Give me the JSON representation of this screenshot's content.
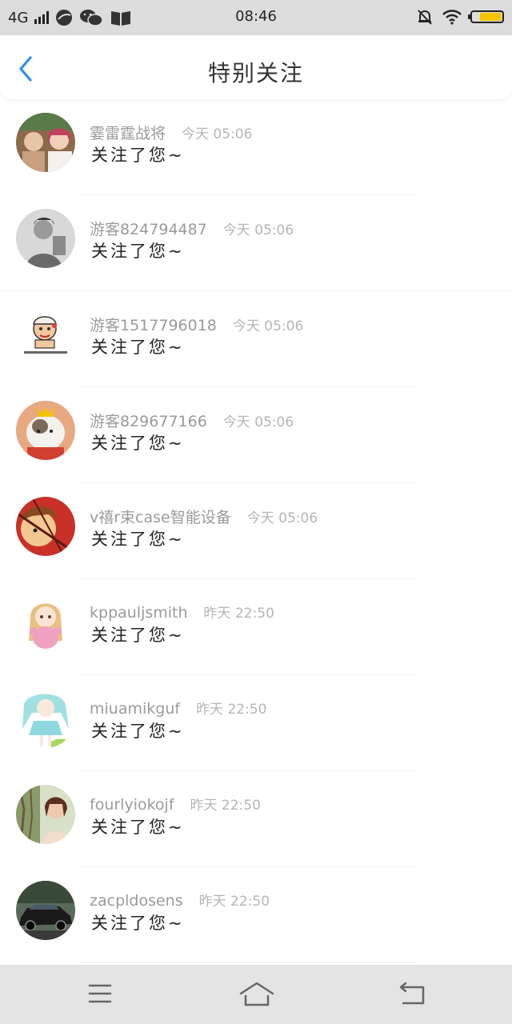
{
  "status_bar": {
    "network": "4G",
    "time": "08:46"
  },
  "header": {
    "title": "特别关注"
  },
  "items": [
    {
      "name": "霎雷霆战将",
      "time": "今天 05:06",
      "message": "关注了您~",
      "avatar_icon": "avatar-photo-two-women"
    },
    {
      "name": "游客824794487",
      "time": "今天 05:06",
      "message": "关注了您~",
      "avatar_icon": "avatar-photo-grayscale-man"
    },
    {
      "name": "游客1517796018",
      "time": "今天 05:06",
      "message": "关注了您~",
      "avatar_icon": "avatar-cartoon-meme"
    },
    {
      "name": "游客829677166",
      "time": "今天 05:06",
      "message": "关注了您~",
      "avatar_icon": "avatar-photo-hamster"
    },
    {
      "name": "v禧r束case智能设备",
      "time": "今天 05:06",
      "message": "关注了您~",
      "avatar_icon": "avatar-anime-red"
    },
    {
      "name": "kppauljsmith",
      "time": "昨天 22:50",
      "message": "关注了您~",
      "avatar_icon": "avatar-anime-girl-pink"
    },
    {
      "name": "miuamikguf",
      "time": "昨天 22:50",
      "message": "关注了您~",
      "avatar_icon": "avatar-anime-girl-teal"
    },
    {
      "name": "fourlyiokojf",
      "time": "昨天 22:50",
      "message": "关注了您~",
      "avatar_icon": "avatar-photo-woman-outdoor"
    },
    {
      "name": "zacpldosens",
      "time": "昨天 22:50",
      "message": "关注了您~",
      "avatar_icon": "avatar-photo-car"
    }
  ],
  "colors": {
    "accent": "#2b8fe8",
    "battery": "#f4c400"
  }
}
